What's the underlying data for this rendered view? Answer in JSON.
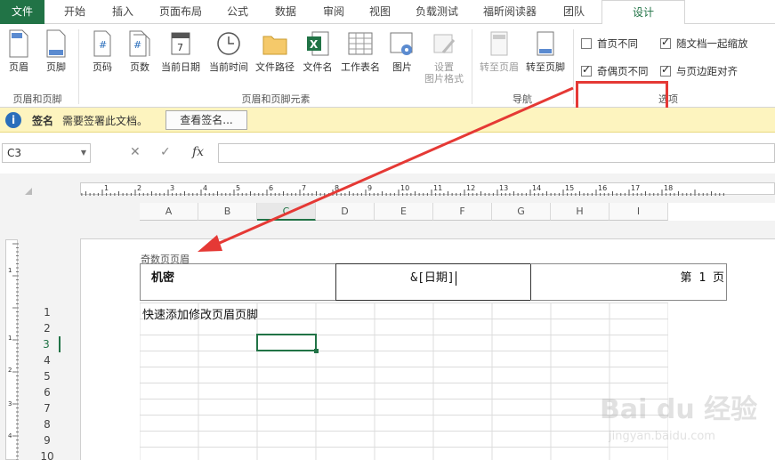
{
  "tabs": [
    "文件",
    "开始",
    "插入",
    "页面布局",
    "公式",
    "数据",
    "审阅",
    "视图",
    "负载测试",
    "福昕阅读器",
    "团队",
    "设计"
  ],
  "ribbon": {
    "header_btn": "页眉",
    "footer_btn": "页脚",
    "group1": "页眉和页脚",
    "elements": [
      "页码",
      "页数",
      "当前日期",
      "当前时间",
      "文件路径",
      "文件名",
      "工作表名",
      "图片",
      "设置\n图片格式"
    ],
    "group2": "页眉和页脚元素",
    "nav": [
      "转至页眉",
      "转至页脚"
    ],
    "group3": "导航",
    "options": {
      "first_page_diff": "首页不同",
      "odd_even_diff": "奇偶页不同",
      "scale_with_doc": "随文档一起缩放",
      "align_margins": "与页边距对齐"
    },
    "group4": "选项"
  },
  "message_bar": {
    "icon": "i",
    "title": "签名",
    "text": "需要签署此文档。",
    "button": "查看签名..."
  },
  "formula_bar": {
    "name_box": "C3",
    "cancel": "✕",
    "enter": "✓",
    "fx": "fx",
    "value": ""
  },
  "columns": [
    "A",
    "B",
    "C",
    "D",
    "E",
    "F",
    "G",
    "H",
    "I"
  ],
  "selected_column": "C",
  "rows": [
    "1",
    "2",
    "3",
    "4",
    "5",
    "6",
    "7",
    "8",
    "9",
    "10"
  ],
  "selected_row": "3",
  "ruler_numbers": [
    "1",
    "2",
    "3",
    "4",
    "5",
    "6",
    "7",
    "8",
    "9",
    "10",
    "11",
    "12",
    "13",
    "14",
    "15",
    "16",
    "17",
    "18"
  ],
  "ruler_v_numbers": [
    "1",
    "1",
    "2",
    "3",
    "4"
  ],
  "header_area": {
    "label": "奇数页页眉",
    "left": "机密",
    "center": "&[日期]",
    "right": "第 1 页"
  },
  "cell_a1": "快速添加修改页眉页脚",
  "colors": {
    "accent": "#217346",
    "highlight": "#e53935",
    "message_bg": "#fdf4bf"
  },
  "watermark": {
    "logo": "Bai du 经验",
    "url": "jingyan.baidu.com"
  }
}
